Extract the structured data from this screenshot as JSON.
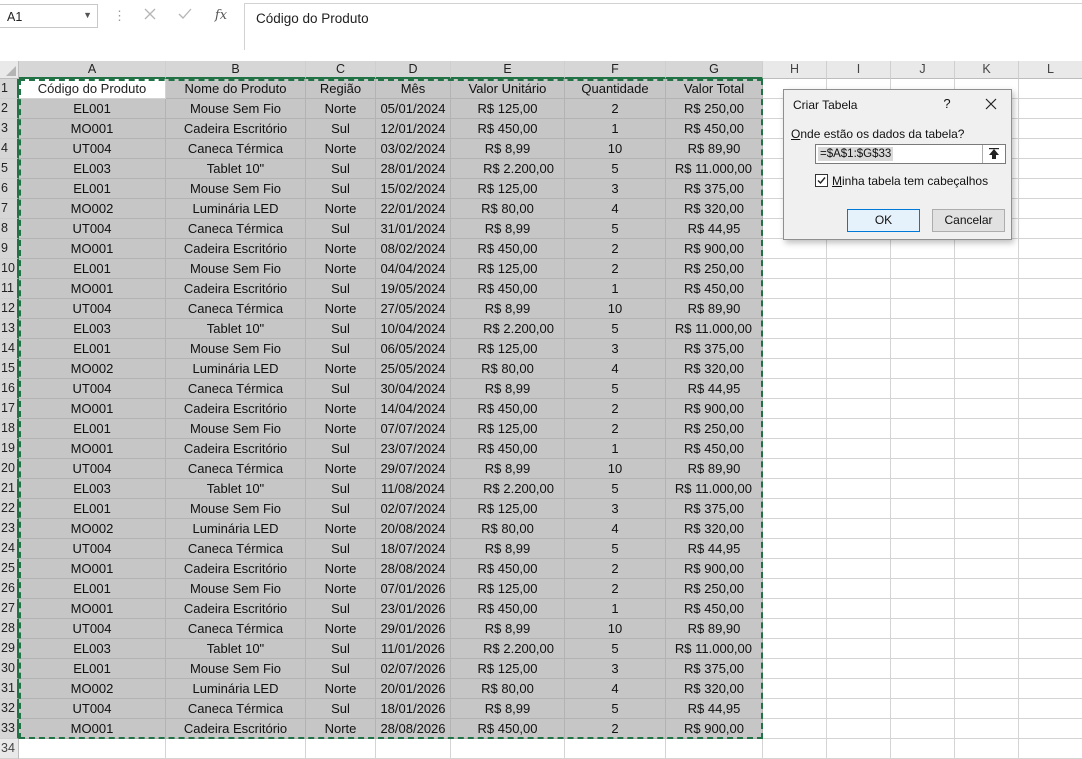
{
  "formula_bar": {
    "name_box": "A1",
    "cancel_icon": "x-icon",
    "enter_icon": "check-icon",
    "fx_label": "fx",
    "content": "Código do Produto"
  },
  "columns": [
    "A",
    "B",
    "C",
    "D",
    "E",
    "F",
    "G",
    "H",
    "I",
    "J",
    "K",
    "L"
  ],
  "table": {
    "headers": [
      "Código do Produto",
      "Nome do Produto",
      "Região",
      "Mês",
      "Valor Unitário",
      "Quantidade",
      "Valor Total"
    ],
    "rows": [
      [
        "EL001",
        "Mouse Sem Fio",
        "Norte",
        "05/01/2024",
        "R$ 125,00",
        "2",
        "R$ 250,00"
      ],
      [
        "MO001",
        "Cadeira Escritório",
        "Sul",
        "12/01/2024",
        "R$ 450,00",
        "1",
        "R$ 450,00"
      ],
      [
        "UT004",
        "Caneca Térmica",
        "Norte",
        "03/02/2024",
        "R$ 8,99",
        "10",
        "R$ 89,90"
      ],
      [
        "EL003",
        "Tablet 10\"",
        "Sul",
        "28/01/2024",
        "R$ 2.200,00",
        "5",
        "R$ 11.000,00"
      ],
      [
        "EL001",
        "Mouse Sem Fio",
        "Sul",
        "15/02/2024",
        "R$ 125,00",
        "3",
        "R$ 375,00"
      ],
      [
        "MO002",
        "Luminária LED",
        "Norte",
        "22/01/2024",
        "R$ 80,00",
        "4",
        "R$ 320,00"
      ],
      [
        "UT004",
        "Caneca Térmica",
        "Sul",
        "31/01/2024",
        "R$ 8,99",
        "5",
        "R$ 44,95"
      ],
      [
        "MO001",
        "Cadeira Escritório",
        "Norte",
        "08/02/2024",
        "R$ 450,00",
        "2",
        "R$ 900,00"
      ],
      [
        "EL001",
        "Mouse Sem Fio",
        "Norte",
        "04/04/2024",
        "R$ 125,00",
        "2",
        "R$ 250,00"
      ],
      [
        "MO001",
        "Cadeira Escritório",
        "Sul",
        "19/05/2024",
        "R$ 450,00",
        "1",
        "R$ 450,00"
      ],
      [
        "UT004",
        "Caneca Térmica",
        "Norte",
        "27/05/2024",
        "R$ 8,99",
        "10",
        "R$ 89,90"
      ],
      [
        "EL003",
        "Tablet 10\"",
        "Sul",
        "10/04/2024",
        "R$ 2.200,00",
        "5",
        "R$ 11.000,00"
      ],
      [
        "EL001",
        "Mouse Sem Fio",
        "Sul",
        "06/05/2024",
        "R$ 125,00",
        "3",
        "R$ 375,00"
      ],
      [
        "MO002",
        "Luminária LED",
        "Norte",
        "25/05/2024",
        "R$ 80,00",
        "4",
        "R$ 320,00"
      ],
      [
        "UT004",
        "Caneca Térmica",
        "Sul",
        "30/04/2024",
        "R$ 8,99",
        "5",
        "R$ 44,95"
      ],
      [
        "MO001",
        "Cadeira Escritório",
        "Norte",
        "14/04/2024",
        "R$ 450,00",
        "2",
        "R$ 900,00"
      ],
      [
        "EL001",
        "Mouse Sem Fio",
        "Norte",
        "07/07/2024",
        "R$ 125,00",
        "2",
        "R$ 250,00"
      ],
      [
        "MO001",
        "Cadeira Escritório",
        "Sul",
        "23/07/2024",
        "R$ 450,00",
        "1",
        "R$ 450,00"
      ],
      [
        "UT004",
        "Caneca Térmica",
        "Norte",
        "29/07/2024",
        "R$ 8,99",
        "10",
        "R$ 89,90"
      ],
      [
        "EL003",
        "Tablet 10\"",
        "Sul",
        "11/08/2024",
        "R$ 2.200,00",
        "5",
        "R$ 11.000,00"
      ],
      [
        "EL001",
        "Mouse Sem Fio",
        "Sul",
        "02/07/2024",
        "R$ 125,00",
        "3",
        "R$ 375,00"
      ],
      [
        "MO002",
        "Luminária LED",
        "Norte",
        "20/08/2024",
        "R$ 80,00",
        "4",
        "R$ 320,00"
      ],
      [
        "UT004",
        "Caneca Térmica",
        "Sul",
        "18/07/2024",
        "R$ 8,99",
        "5",
        "R$ 44,95"
      ],
      [
        "MO001",
        "Cadeira Escritório",
        "Norte",
        "28/08/2024",
        "R$ 450,00",
        "2",
        "R$ 900,00"
      ],
      [
        "EL001",
        "Mouse Sem Fio",
        "Norte",
        "07/01/2026",
        "R$ 125,00",
        "2",
        "R$ 250,00"
      ],
      [
        "MO001",
        "Cadeira Escritório",
        "Sul",
        "23/01/2026",
        "R$ 450,00",
        "1",
        "R$ 450,00"
      ],
      [
        "UT004",
        "Caneca Térmica",
        "Norte",
        "29/01/2026",
        "R$ 8,99",
        "10",
        "R$ 89,90"
      ],
      [
        "EL003",
        "Tablet 10\"",
        "Sul",
        "11/01/2026",
        "R$ 2.200,00",
        "5",
        "R$ 11.000,00"
      ],
      [
        "EL001",
        "Mouse Sem Fio",
        "Sul",
        "02/07/2026",
        "R$ 125,00",
        "3",
        "R$ 375,00"
      ],
      [
        "MO002",
        "Luminária LED",
        "Norte",
        "20/01/2026",
        "R$ 80,00",
        "4",
        "R$ 320,00"
      ],
      [
        "UT004",
        "Caneca Térmica",
        "Sul",
        "18/01/2026",
        "R$ 8,99",
        "5",
        "R$ 44,95"
      ],
      [
        "MO001",
        "Cadeira Escritório",
        "Norte",
        "28/08/2026",
        "R$ 450,00",
        "2",
        "R$ 900,00"
      ]
    ]
  },
  "dialog": {
    "title": "Criar Tabela",
    "help": "?",
    "question": "Onde estão os dados da tabela?",
    "range": "=$A$1:$G$33",
    "checkbox_label": "Minha tabela tem cabeçalhos",
    "checkbox_checked": true,
    "ok": "OK",
    "cancel": "Cancelar"
  },
  "colors": {
    "accent": "#217346",
    "selection_shade": "#c6c6c6"
  }
}
